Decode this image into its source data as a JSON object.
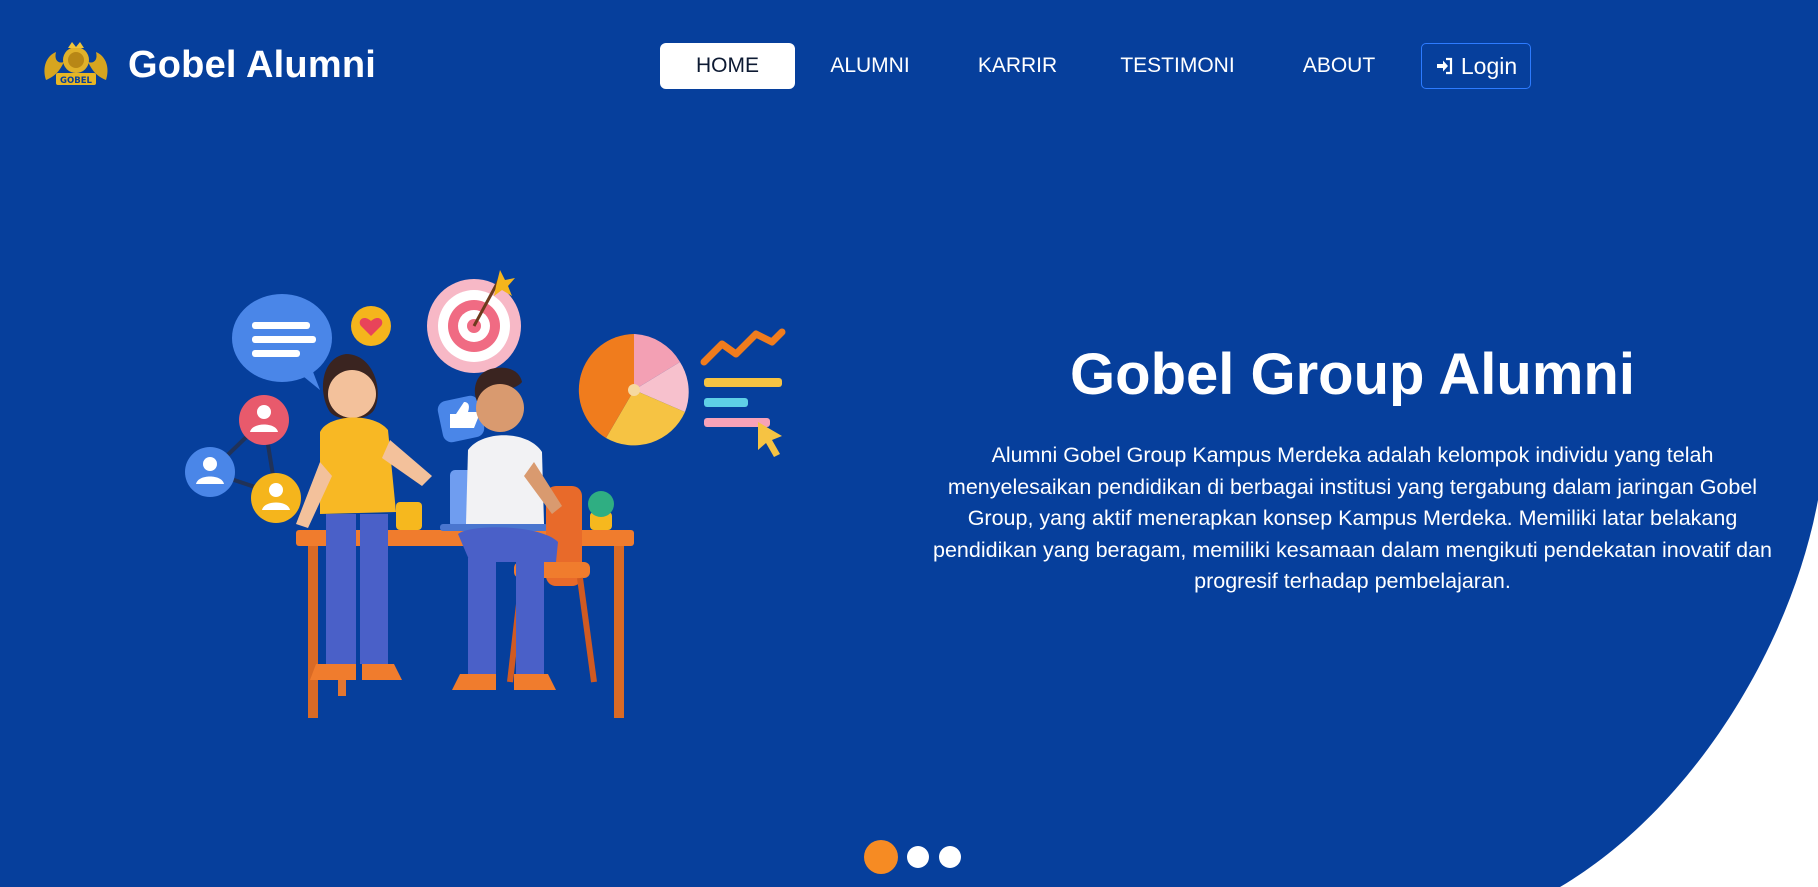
{
  "colors": {
    "hero_background": "#063f9c",
    "page_background": "#ffffff",
    "accent_orange": "#f68b23",
    "login_border": "#2d7bff",
    "active_nav_text": "#0d1a33"
  },
  "brand": {
    "logo_text": "GOBEL",
    "logo_icon": "gobel-crest-icon",
    "name": "Gobel Alumni"
  },
  "nav": {
    "items": [
      {
        "label": "HOME",
        "active": true
      },
      {
        "label": "ALUMNI",
        "active": false
      },
      {
        "label": "KARRIR",
        "active": false
      },
      {
        "label": "TESTIMONI",
        "active": false
      },
      {
        "label": "ABOUT",
        "active": false
      }
    ],
    "login": {
      "label": "Login",
      "icon": "sign-in-icon"
    }
  },
  "hero": {
    "title": "Gobel Group Alumni",
    "description": "Alumni Gobel Group Kampus Merdeka adalah kelompok individu yang telah menyelesaikan pendidikan di berbagai institusi yang tergabung dalam jaringan Gobel Group, yang aktif menerapkan konsep Kampus Merdeka. Memiliki latar belakang pendidikan yang beragam, memiliki kesamaan dalam mengikuti pendekatan inovatif dan progresif terhadap pembelajaran.",
    "illustration": "teamwork-illustration"
  },
  "carousel": {
    "slide_count": 3,
    "active_slide": 1
  }
}
